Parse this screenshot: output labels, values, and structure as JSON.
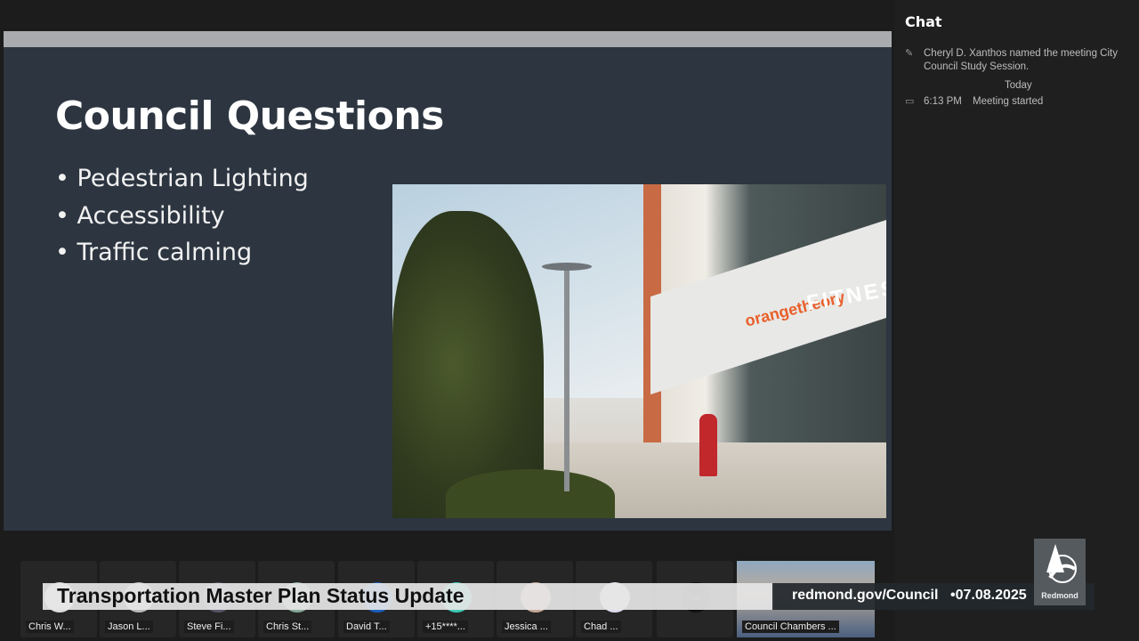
{
  "slide": {
    "title": "Council Questions",
    "bullets": [
      "Pedestrian Lighting",
      "Accessibility",
      "Traffic calming"
    ],
    "photo_signs": [
      "orangetheory",
      "FITNESS"
    ]
  },
  "chat": {
    "title": "Chat",
    "rename_event": "Cheryl D. Xanthos named the meeting City Council Study Session.",
    "day_label": "Today",
    "start_time": "6:13 PM",
    "start_text": "Meeting started"
  },
  "participants": [
    "Chris W...",
    "Jason L...",
    "Steve Fi...",
    "Chris St...",
    "David T...",
    "+15****...",
    "Jessica ...",
    "Chad ..."
  ],
  "overflow_label": "...",
  "room_tile": "Council Chambers ...",
  "broadcast": {
    "title": "Transportation Master Plan Status Update",
    "url": "redmond.gov/Council",
    "date": "•07.08.2025",
    "logo_text": "Redmond"
  }
}
